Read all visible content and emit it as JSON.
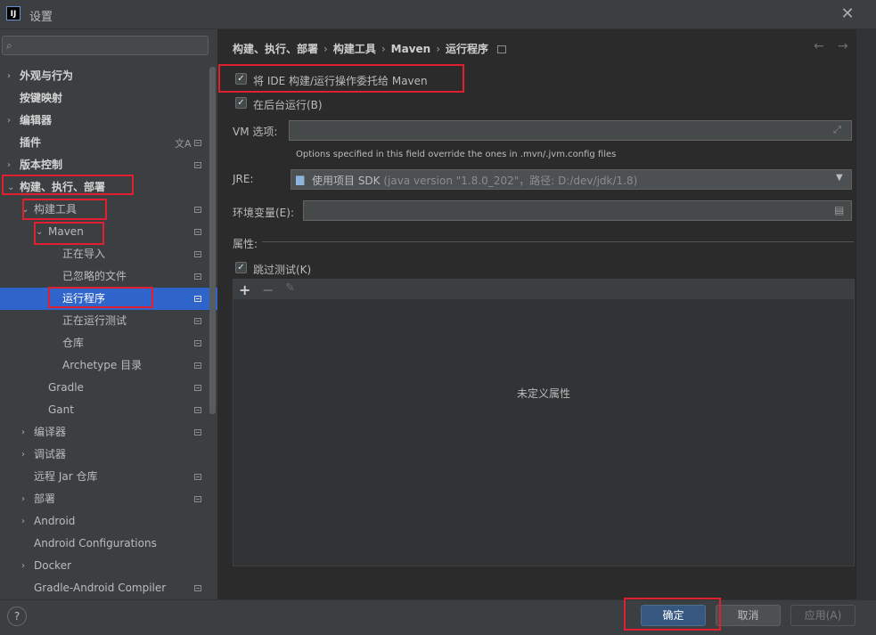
{
  "window": {
    "title": "设置",
    "icon_text": "IJ"
  },
  "search": {
    "placeholder": ""
  },
  "tree": [
    {
      "label": "外观与行为",
      "indent": 0,
      "arrow": "›",
      "bold": true,
      "mark": false
    },
    {
      "label": "按键映射",
      "indent": 0,
      "arrow": "",
      "bold": true,
      "mark": false
    },
    {
      "label": "编辑器",
      "indent": 0,
      "arrow": "›",
      "bold": true,
      "mark": false
    },
    {
      "label": "插件",
      "indent": 0,
      "arrow": "",
      "bold": true,
      "mark": true
    },
    {
      "label": "版本控制",
      "indent": 0,
      "arrow": "›",
      "bold": true,
      "mark": true
    },
    {
      "label": "构建、执行、部署",
      "indent": 0,
      "arrow": "⌄",
      "bold": true,
      "mark": false
    },
    {
      "label": "构建工具",
      "indent": 1,
      "arrow": "⌄",
      "bold": false,
      "mark": true
    },
    {
      "label": "Maven",
      "indent": 2,
      "arrow": "⌄",
      "bold": false,
      "mark": true
    },
    {
      "label": "正在导入",
      "indent": 3,
      "arrow": "",
      "bold": false,
      "mark": true
    },
    {
      "label": "已忽略的文件",
      "indent": 3,
      "arrow": "",
      "bold": false,
      "mark": true
    },
    {
      "label": "运行程序",
      "indent": 3,
      "arrow": "",
      "bold": false,
      "mark": true,
      "selected": true
    },
    {
      "label": "正在运行测试",
      "indent": 3,
      "arrow": "",
      "bold": false,
      "mark": true
    },
    {
      "label": "仓库",
      "indent": 3,
      "arrow": "",
      "bold": false,
      "mark": true
    },
    {
      "label": "Archetype 目录",
      "indent": 3,
      "arrow": "",
      "bold": false,
      "mark": true
    },
    {
      "label": "Gradle",
      "indent": 2,
      "arrow": "",
      "bold": false,
      "mark": true
    },
    {
      "label": "Gant",
      "indent": 2,
      "arrow": "",
      "bold": false,
      "mark": true
    },
    {
      "label": "编译器",
      "indent": 1,
      "arrow": "›",
      "bold": false,
      "mark": true
    },
    {
      "label": "调试器",
      "indent": 1,
      "arrow": "›",
      "bold": false,
      "mark": false
    },
    {
      "label": "远程 Jar 仓库",
      "indent": 1,
      "arrow": "",
      "bold": false,
      "mark": true
    },
    {
      "label": "部署",
      "indent": 1,
      "arrow": "›",
      "bold": false,
      "mark": true
    },
    {
      "label": "Android",
      "indent": 1,
      "arrow": "›",
      "bold": false,
      "mark": false
    },
    {
      "label": "Android Configurations",
      "indent": 1,
      "arrow": "",
      "bold": false,
      "mark": false
    },
    {
      "label": "Docker",
      "indent": 1,
      "arrow": "›",
      "bold": false,
      "mark": false
    },
    {
      "label": "Gradle-Android Compiler",
      "indent": 1,
      "arrow": "",
      "bold": false,
      "mark": true
    }
  ],
  "breadcrumb": [
    "构建、执行、部署",
    "构建工具",
    "Maven",
    "运行程序"
  ],
  "delegate": {
    "label": "将 IDE 构建/运行操作委托给 Maven",
    "checked": true
  },
  "background": {
    "label": "在后台运行(B)",
    "checked": true
  },
  "vm": {
    "label": "VM 选项:",
    "value": "",
    "hint": "Options specified in this field override the ones in .mvn/.jvm.config files"
  },
  "jre": {
    "label": "JRE:",
    "value": "使用项目 SDK",
    "detail": " (java version \"1.8.0_202\"，路径: D:/dev/jdk/1.8)"
  },
  "env": {
    "label": "环境变量(E):",
    "value": ""
  },
  "properties": {
    "label": "属性:",
    "skip_tests": {
      "label": "跳过测试(K)",
      "checked": true
    },
    "empty_text": "未定义属性"
  },
  "buttons": {
    "ok": "确定",
    "cancel": "取消",
    "apply": "应用(A)",
    "help": "?"
  },
  "colors": {
    "selection": "#2f65ca",
    "annotation": "#e0202e",
    "ok_button": "#365880"
  }
}
